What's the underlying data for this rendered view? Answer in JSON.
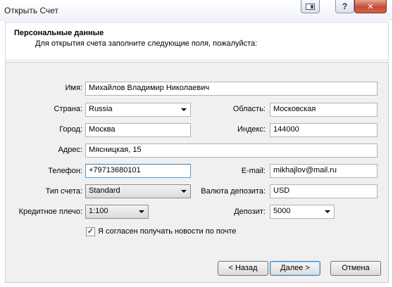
{
  "window": {
    "title": "Открыть Счет",
    "close_glyph": "✕",
    "help_glyph": "?"
  },
  "header": {
    "title": "Персональные данные",
    "subtitle": "Для открытия счета заполните следующие поля, пожалуйста:"
  },
  "form": {
    "name": {
      "label": "Имя:",
      "value": "Михайлов Владимир Николаевич"
    },
    "country": {
      "label": "Страна:",
      "value": "Russia"
    },
    "region": {
      "label": "Область:",
      "value": "Московская"
    },
    "city": {
      "label": "Город:",
      "value": "Москва"
    },
    "index": {
      "label": "Индекс:",
      "value": "144000"
    },
    "address": {
      "label": "Адрес:",
      "value": "Мясницкая, 15"
    },
    "phone": {
      "label": "Телефон:",
      "value": "+79713680101"
    },
    "email": {
      "label": "E-mail:",
      "value": "mikhajlov@mail.ru"
    },
    "account_type": {
      "label": "Тип счета:",
      "value": "Standard"
    },
    "currency": {
      "label": "Валюта депозита:",
      "value": "USD"
    },
    "leverage": {
      "label": "Кредитное плечо:",
      "value": "1:100"
    },
    "deposit": {
      "label": "Депозит:",
      "value": "5000"
    },
    "newsletter": {
      "label": "Я согласен получать новости по почте",
      "checked": true,
      "mark": "✓"
    }
  },
  "buttons": {
    "back": "< Назад",
    "next": "Далее >",
    "cancel": "Отмена"
  }
}
